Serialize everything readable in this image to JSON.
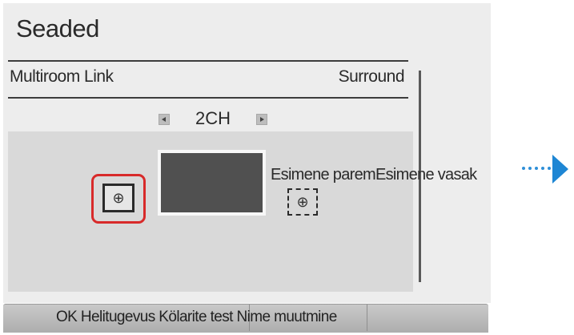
{
  "screen": {
    "title": "Seaded"
  },
  "menu_row": {
    "left_label": "Multiroom Link",
    "right_label": "Surround"
  },
  "mode_selector": {
    "value": "2CH",
    "left_arrow_icon": "triangle-left-icon",
    "right_arrow_icon": "triangle-right-icon"
  },
  "speakers": {
    "label": "Esimene paremEsimene vasak",
    "icon_glyph": "⊕"
  },
  "bottom_bar": {
    "text": "OK Helitugevus Kölarite test Nime muutmine"
  },
  "colors": {
    "selection_ring": "#d82a2a",
    "next_arrow": "#1e86d4",
    "panel_bg": "#ededed",
    "canvas_bg": "#d9d9d9",
    "tv_fill": "#505050"
  },
  "decorations": {
    "next_indicator_icon": "arrow-right-dotted-icon"
  }
}
